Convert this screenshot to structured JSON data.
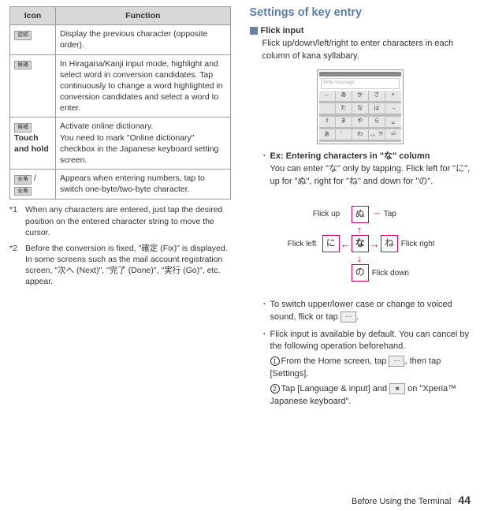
{
  "table": {
    "headers": [
      "Icon",
      "Function"
    ],
    "rows": [
      {
        "icon": "逆順",
        "text": "Display the previous character (opposite order)."
      },
      {
        "icon": "候補",
        "text": "In Hiragana/Kanji input mode, highlight and select word in conversion candidates. Tap continuously to change a word highlighted in conversion candidates and select a word to enter."
      },
      {
        "icon": "候補",
        "iconExtra": "Touch and hold",
        "text": "Activate online dictionary.\nYou need to mark \"Online dictionary\" checkbox in the Japanese keyboard setting screen."
      },
      {
        "icon": "全角",
        "icon2": "全角",
        "text": "Appears when entering numbers, tap to switch one-byte/two-byte character."
      }
    ]
  },
  "notes": [
    {
      "mark": "*1",
      "text": "When any characters are entered, just tap the desired position on the entered character string to move the cursor."
    },
    {
      "mark": "*2",
      "text": "Before the conversion is fixed, \"確定 (Fix)\" is displayed. In some screens such as the mail account registration screen, \"次へ (Next)\", \"完了 (Done)\", \"実行 (Go)\", etc. appear."
    }
  ],
  "right": {
    "heading": "Settings of key entry",
    "flickInput": "Flick input",
    "flickDesc": "Flick up/down/left/right to enter characters in each column of kana syllabary.",
    "screenshot_placeholder": "Write message",
    "kana_grid": [
      "←",
      "あ",
      "か",
      "さ",
      "×",
      "",
      "た",
      "な",
      "は",
      "→",
      "⇧",
      "ま",
      "や",
      "ら",
      "␣",
      "あ",
      "゛",
      "わ",
      "、。?!",
      "⏎"
    ],
    "exTitle": "Ex: Entering characters in \"な\" column",
    "exBody": "You can enter \"な\" only by tapping. Flick left for \"に\", up for \"ぬ\", right for \"ね\" and down for \"の\".",
    "diagram": {
      "center": "な",
      "up": "ぬ",
      "down": "の",
      "left": "に",
      "right": "ね",
      "upLabel": "Flick up",
      "downLabel": "Flick down",
      "leftLabel": "Flick left",
      "rightLabel": "Flick right",
      "tapLabel": "Tap"
    },
    "bullet2": "To switch upper/lower case or change to voiced sound, flick or tap ",
    "bullet3": "Flick input is available by default. You can cancel by the following operation beforehand.",
    "step1a": "From the Home screen, tap ",
    "step1b": ", then tap [Settings].",
    "step2a": "Tap [Language & input] and ",
    "step2b": " on \"Xperia™ Japanese keyboard\"."
  },
  "footer": {
    "text": "Before Using the Terminal",
    "page": "44"
  }
}
